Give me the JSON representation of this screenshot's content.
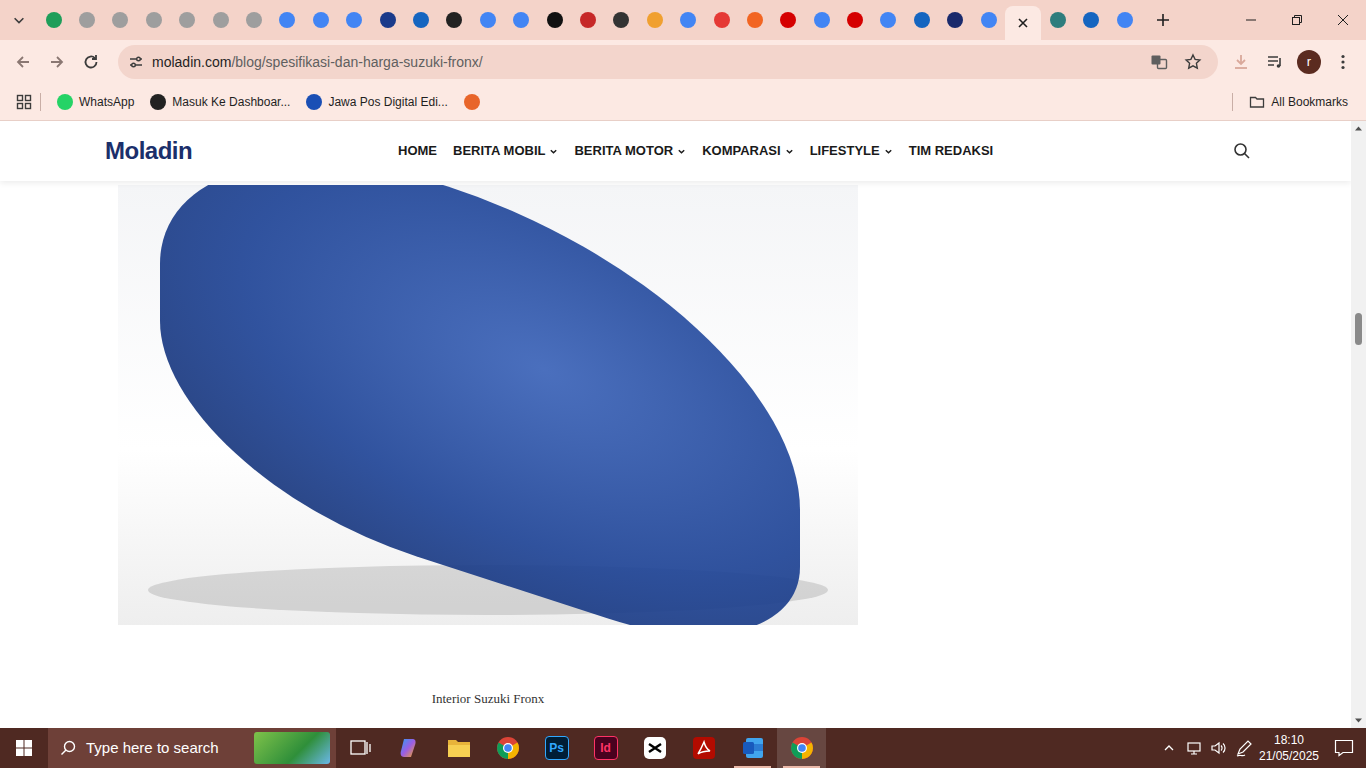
{
  "browser": {
    "tabs": [
      {
        "selected": false,
        "color": "#1e9e5a"
      },
      {
        "selected": false,
        "color": "#9e9e9e"
      },
      {
        "selected": false,
        "color": "#9e9e9e"
      },
      {
        "selected": false,
        "color": "#9e9e9e"
      },
      {
        "selected": false,
        "color": "#9e9e9e"
      },
      {
        "selected": false,
        "color": "#9e9e9e"
      },
      {
        "selected": false,
        "color": "#9e9e9e"
      },
      {
        "selected": false,
        "color": "#4285f4"
      },
      {
        "selected": false,
        "color": "#4285f4"
      },
      {
        "selected": false,
        "color": "#4285f4"
      },
      {
        "selected": false,
        "color": "#1a3a8a"
      },
      {
        "selected": false,
        "color": "#1565c0"
      },
      {
        "selected": false,
        "color": "#222222"
      },
      {
        "selected": false,
        "color": "#4285f4"
      },
      {
        "selected": false,
        "color": "#4285f4"
      },
      {
        "selected": false,
        "color": "#111111"
      },
      {
        "selected": false,
        "color": "#c62828"
      },
      {
        "selected": false,
        "color": "#333333"
      },
      {
        "selected": false,
        "color": "#f0a030"
      },
      {
        "selected": false,
        "color": "#4285f4"
      },
      {
        "selected": false,
        "color": "#e53935"
      },
      {
        "selected": false,
        "color": "#f26522"
      },
      {
        "selected": false,
        "color": "#d50000"
      },
      {
        "selected": false,
        "color": "#4285f4"
      },
      {
        "selected": false,
        "color": "#d50000"
      },
      {
        "selected": false,
        "color": "#4285f4"
      },
      {
        "selected": false,
        "color": "#1565c0"
      },
      {
        "selected": false,
        "color": "#1a2a6c"
      },
      {
        "selected": false,
        "color": "#4285f4"
      },
      {
        "selected": true
      },
      {
        "selected": false,
        "color": "#2e7d7d"
      },
      {
        "selected": false,
        "color": "#1565c0"
      },
      {
        "selected": false,
        "color": "#4285f4"
      }
    ],
    "address": {
      "host": "moladin.com",
      "path": "/blog/spesifikasi-dan-harga-suzuki-fronx/"
    },
    "profile": "r",
    "bookmarks": [
      {
        "label": "WhatsApp",
        "color": "#25d366"
      },
      {
        "label": "Masuk Ke Dashboar...",
        "color": "#222222"
      },
      {
        "label": "Jawa Pos Digital Edi...",
        "color": "#1a4fb5"
      },
      {
        "color": "#e8652a"
      }
    ],
    "all_bookmarks": "All Bookmarks"
  },
  "site": {
    "logo": "Moladin",
    "nav": [
      {
        "label": "HOME",
        "dropdown": false
      },
      {
        "label": "BERITA MOBIL",
        "dropdown": true
      },
      {
        "label": "BERITA MOTOR",
        "dropdown": true
      },
      {
        "label": "KOMPARASI",
        "dropdown": true
      },
      {
        "label": "LIFESTYLE",
        "dropdown": true
      },
      {
        "label": "TIM REDAKSI",
        "dropdown": false
      }
    ]
  },
  "article": {
    "caption": "Interior Suzuki Fronx"
  },
  "scrollbar": {
    "level": 0.325
  },
  "taskbar": {
    "search_placeholder": "Type here to search",
    "apps": [
      {
        "kind": "taskview",
        "running": false,
        "selected": false
      },
      {
        "kind": "copilot",
        "running": false,
        "selected": false
      },
      {
        "kind": "explorer",
        "running": false,
        "selected": false
      },
      {
        "kind": "chrome",
        "running": false,
        "selected": false
      },
      {
        "kind": "photoshop",
        "label": "Ps",
        "running": false,
        "selected": false
      },
      {
        "kind": "indesign",
        "label": "Id",
        "running": false,
        "selected": false
      },
      {
        "kind": "capcut",
        "running": false,
        "selected": false
      },
      {
        "kind": "acrobat",
        "running": false,
        "selected": false
      },
      {
        "kind": "word",
        "running": true,
        "selected": false
      },
      {
        "kind": "chrome",
        "running": true,
        "selected": true
      }
    ],
    "time": "18:10",
    "date": "21/05/2025"
  }
}
